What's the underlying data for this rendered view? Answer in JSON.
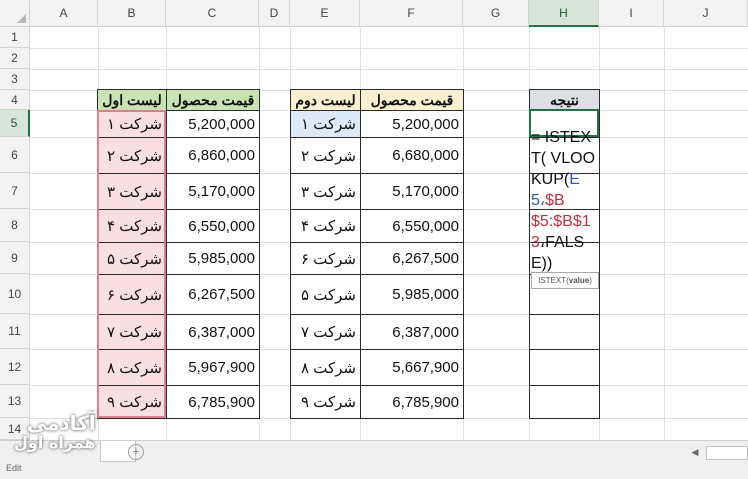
{
  "columns": [
    "A",
    "B",
    "C",
    "D",
    "E",
    "F",
    "G",
    "H",
    "I",
    "J"
  ],
  "rows": [
    "1",
    "2",
    "3",
    "4",
    "5",
    "6",
    "7",
    "8",
    "9",
    "10",
    "11",
    "12",
    "13",
    "14"
  ],
  "active_column": "H",
  "active_row": "5",
  "table1": {
    "header_name": "لیست اول",
    "header_price": "قیمت محصول",
    "rows": [
      {
        "name": "شرکت ۱",
        "price": "5,200,000"
      },
      {
        "name": "شرکت ۲",
        "price": "6,860,000"
      },
      {
        "name": "شرکت ۳",
        "price": "5,170,000"
      },
      {
        "name": "شرکت ۴",
        "price": "6,550,000"
      },
      {
        "name": "شرکت ۵",
        "price": "5,985,000"
      },
      {
        "name": "شرکت ۶",
        "price": "6,267,500"
      },
      {
        "name": "شرکت ۷",
        "price": "6,387,000"
      },
      {
        "name": "شرکت ۸",
        "price": "5,967,900"
      },
      {
        "name": "شرکت ۹",
        "price": "6,785,900"
      }
    ]
  },
  "table2": {
    "header_name": "لیست دوم",
    "header_price": "قیمت محصول",
    "rows": [
      {
        "name": "شرکت ۱",
        "price": "5,200,000"
      },
      {
        "name": "شرکت ۲",
        "price": "6,680,000"
      },
      {
        "name": "شرکت ۳",
        "price": "5,170,000"
      },
      {
        "name": "شرکت ۴",
        "price": "6,550,000"
      },
      {
        "name": "شرکت ۶",
        "price": "6,267,500"
      },
      {
        "name": "شرکت ۵",
        "price": "5,985,000"
      },
      {
        "name": "شرکت ۷",
        "price": "6,387,000"
      },
      {
        "name": "شرکت ۸",
        "price": "5,667,900"
      },
      {
        "name": "شرکت ۹",
        "price": "6,785,900"
      }
    ]
  },
  "result": {
    "header": "نتیجه",
    "formula_parts": {
      "p1": "= ISTEXT( VLOOKUP(",
      "p2": "E5",
      "p3": "$B$5:$B$13",
      "p4": "FALSE))",
      "sep": "،"
    },
    "tooltip_fn": "ISTEXT(",
    "tooltip_arg": "value",
    "tooltip_end": ")"
  },
  "status": {
    "mode": "Edit"
  },
  "logo": {
    "line1": "آکادمی",
    "line2": "همراه اول"
  },
  "colors": {
    "excel_green": "#217346",
    "table1_header": "#c9e3b4",
    "table1_body": "#f9dfe1",
    "table2_header": "#fdf0d2",
    "result_header": "#dcdfe3",
    "ref_blue": "#2c58b8",
    "ref_red": "#c0303d"
  }
}
